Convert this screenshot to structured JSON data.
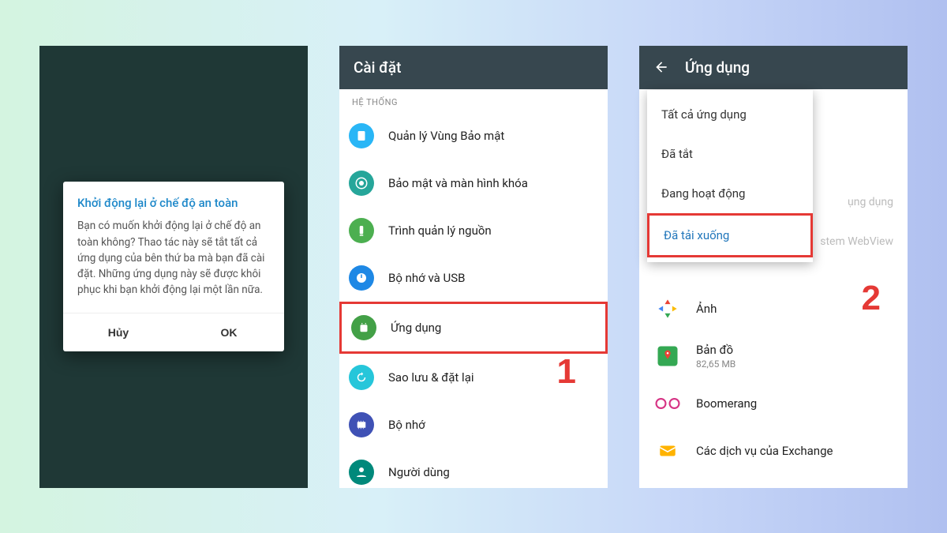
{
  "panel1": {
    "dialog_title": "Khởi động lại ở chế độ an toàn",
    "dialog_body": "Bạn có muốn khởi động lại ở chế độ an toàn không? Thao tác này sẽ tắt tất cả ứng dụng của bên thứ ba mà bạn đã cài đặt. Những ứng dụng này sẽ được khôi phục khi bạn khởi động lại một lần nữa.",
    "cancel": "Hủy",
    "ok": "OK"
  },
  "panel2": {
    "title": "Cài đặt",
    "section": "HỆ THỐNG",
    "items": [
      {
        "label": "Quản lý Vùng Bảo mật",
        "color": "#29b6f6"
      },
      {
        "label": "Bảo mật và màn hình khóa",
        "color": "#26a69a"
      },
      {
        "label": "Trình quản lý nguồn",
        "color": "#4caf50"
      },
      {
        "label": "Bộ nhớ và USB",
        "color": "#1e88e5"
      },
      {
        "label": "Ứng dụng",
        "color": "#43a047",
        "highlight": true
      },
      {
        "label": "Sao lưu & đặt lại",
        "color": "#26c6da"
      },
      {
        "label": "Bộ nhớ",
        "color": "#3f51b5"
      },
      {
        "label": "Người dùng",
        "color": "#00897b"
      }
    ],
    "step": "1"
  },
  "panel3": {
    "title": "Ứng dụng",
    "dropdown": [
      "Tất cả ứng dụng",
      "Đã tắt",
      "Đang hoạt động",
      "Đã tải xuống"
    ],
    "ghost1": "ụng dụng",
    "ghost2": "stem WebView",
    "apps": [
      {
        "name": "Ảnh",
        "sub": "",
        "iconBg": "#ffffff"
      },
      {
        "name": "Bản đồ",
        "sub": "82,65 MB",
        "iconBg": "#ffffff"
      },
      {
        "name": "Boomerang",
        "sub": "",
        "iconBg": "#ffffff"
      },
      {
        "name": "Các dịch vụ của Exchange",
        "sub": "",
        "iconBg": "#ffffff"
      }
    ],
    "step": "2"
  }
}
